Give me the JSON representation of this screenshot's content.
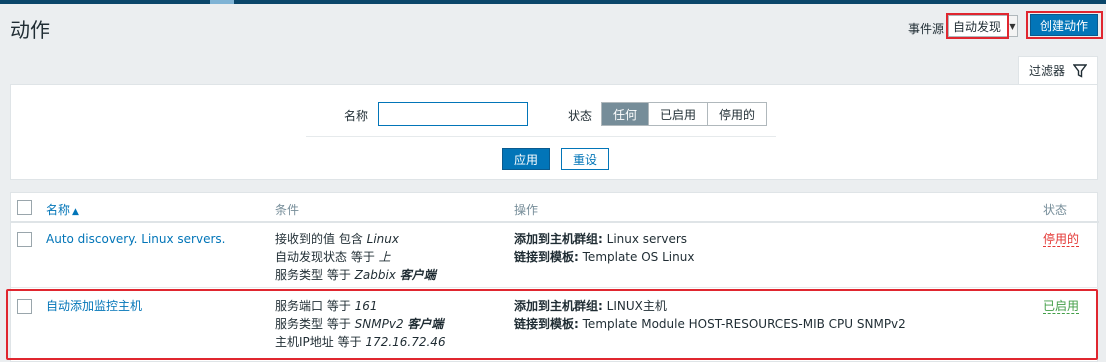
{
  "page": {
    "title": "动作"
  },
  "header": {
    "event_source_label": "事件源",
    "event_source_value": "自动发现",
    "create_button": "创建动作"
  },
  "filter": {
    "tab_label": "过滤器",
    "name_label": "名称",
    "name_value": "",
    "status_label": "状态",
    "status_options": [
      "任何",
      "已启用",
      "停用的"
    ],
    "status_selected": "任何",
    "apply_label": "应用",
    "reset_label": "重设"
  },
  "table": {
    "headers": {
      "name": "名称",
      "sort_indicator": "▲",
      "conditions": "条件",
      "operations": "操作",
      "status": "状态"
    },
    "rows": [
      {
        "name": "Auto discovery. Linux servers.",
        "conditions": [
          {
            "field": "接收到的值 包含",
            "value": "Linux",
            "value_bold": ""
          },
          {
            "field": "自动发现状态 等于",
            "value": "上",
            "value_bold": ""
          },
          {
            "field": "服务类型 等于",
            "value": "Zabbix",
            "value_bold": "客户端"
          }
        ],
        "operations": [
          {
            "label": "添加到主机群组:",
            "value": "Linux servers"
          },
          {
            "label": "链接到模板:",
            "value": "Template OS Linux"
          }
        ],
        "status": "停用的"
      },
      {
        "name": "自动添加监控主机",
        "conditions": [
          {
            "field": "服务端口 等于",
            "value": "161",
            "value_bold": ""
          },
          {
            "field": "服务类型 等于",
            "value": "SNMPv2",
            "value_bold": "客户端"
          },
          {
            "field": "主机IP地址 等于",
            "value": "172.16.72.46",
            "value_bold": ""
          }
        ],
        "operations": [
          {
            "label": "添加到主机群组:",
            "value": "LINUX主机"
          },
          {
            "label": "链接到模板:",
            "value": "Template Module HOST-RESOURCES-MIB CPU SNMPv2"
          }
        ],
        "status": "已启用"
      }
    ]
  },
  "colors": {
    "accent": "#0275b8",
    "highlight": "#e0262f",
    "disabled": "#e33734",
    "enabled": "#429e47"
  }
}
